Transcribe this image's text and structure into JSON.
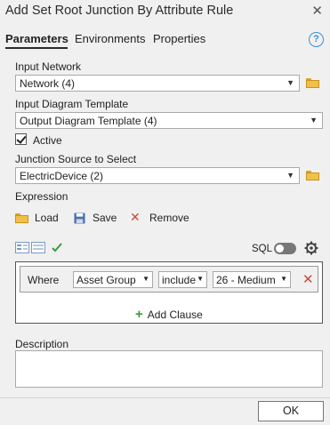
{
  "window": {
    "title": "Add Set Root Junction By Attribute Rule",
    "close_glyph": "✕"
  },
  "tabs": [
    {
      "label": "Parameters",
      "active": true
    },
    {
      "label": "Environments",
      "active": false
    },
    {
      "label": "Properties",
      "active": false
    }
  ],
  "help_glyph": "?",
  "params": {
    "input_network": {
      "label": "Input Network",
      "value": "Network (4)"
    },
    "diagram_template": {
      "label": "Input Diagram Template",
      "value": "Output Diagram Template (4)"
    },
    "active": {
      "label": "Active",
      "checked": true
    },
    "junction_source": {
      "label": "Junction Source to Select",
      "value": "ElectricDevice (2)"
    },
    "expression": {
      "label": "Expression"
    }
  },
  "expression_toolbar": {
    "load": "Load",
    "save": "Save",
    "remove": "Remove"
  },
  "sql": {
    "label": "SQL",
    "enabled": false
  },
  "clause": {
    "where": "Where",
    "field": "Asset Group",
    "operator": "include",
    "value": "26 - Medium",
    "add_clause": "Add Clause"
  },
  "description": {
    "label": "Description",
    "value": ""
  },
  "ok_button": "OK",
  "colors": {
    "accent": "#3b8fd8",
    "remove_red": "#d0473a",
    "add_green": "#3c9a3c",
    "folder": "#f1c04b"
  }
}
